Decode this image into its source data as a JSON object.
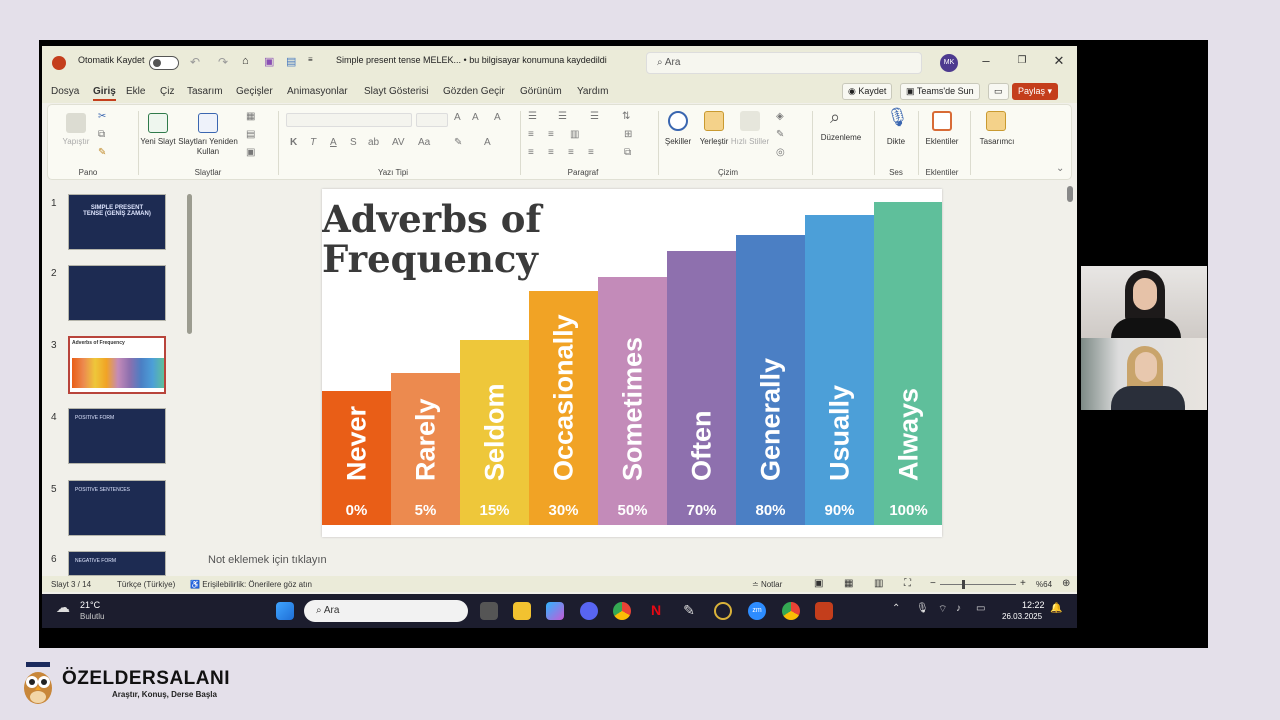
{
  "titlebar": {
    "autosave_label": "Otomatik Kaydet",
    "document_title": "Simple present tense MELEK... • bu bilgisayar konumuna kaydedildi",
    "search_placeholder": "Ara",
    "avatar_initials": "MK"
  },
  "menu_tabs": [
    "Dosya",
    "Giriş",
    "Ekle",
    "Çiz",
    "Tasarım",
    "Geçişler",
    "Animasyonlar",
    "Slayt Gösterisi",
    "Gözden Geçir",
    "Görünüm",
    "Yardım"
  ],
  "active_tab": "Giriş",
  "actions": {
    "save": "Kaydet",
    "teams": "Teams'de Sun",
    "share": "Paylaş"
  },
  "ribbon": {
    "paste": "Yapıştır",
    "new_slide": "Yeni Slayt",
    "reuse_slides": "Slaytları Yeniden Kullan",
    "shapes": "Şekiller",
    "arrange": "Yerleştir",
    "quick_styles": "Hızlı Stiller",
    "editing": "Düzenleme",
    "dictate": "Dikte",
    "addins": "Eklentiler",
    "designer": "Tasarımcı",
    "groups": {
      "clipboard": "Pano",
      "slides": "Slaytlar",
      "font": "Yazı Tipi",
      "paragraph": "Paragraf",
      "drawing": "Çizim",
      "voice": "Ses",
      "addins": "Eklentiler"
    }
  },
  "thumbnails": [
    {
      "num": "1",
      "title": "SIMPLE PRESENT TENSE (GENİŞ ZAMAN)"
    },
    {
      "num": "2",
      "title": ""
    },
    {
      "num": "3",
      "title": "Adverbs of Frequency"
    },
    {
      "num": "4",
      "title": "POSITIVE FORM"
    },
    {
      "num": "5",
      "title": "POSITIVE SENTENCES"
    },
    {
      "num": "6",
      "title": "NEGATIVE FORM"
    }
  ],
  "slide": {
    "title": "Adverbs of\nFrequency",
    "bars": [
      {
        "word": "Never",
        "percent": "0%",
        "level": 0.405,
        "color": "#e95e17"
      },
      {
        "word": "Rarely",
        "percent": "5%",
        "level": 0.46,
        "color": "#ec8a4f"
      },
      {
        "word": "Seldom",
        "percent": "15%",
        "level": 0.56,
        "color": "#eec73a"
      },
      {
        "word": "Occasionally",
        "percent": "30%",
        "level": 0.71,
        "color": "#f1a325"
      },
      {
        "word": "Sometimes",
        "percent": "50%",
        "level": 0.75,
        "color": "#c38bb9"
      },
      {
        "word": "Often",
        "percent": "70%",
        "level": 0.83,
        "color": "#8e70ae"
      },
      {
        "word": "Generally",
        "percent": "80%",
        "level": 0.88,
        "color": "#4b7fc4"
      },
      {
        "word": "Usually",
        "percent": "90%",
        "level": 0.94,
        "color": "#4c9fd8"
      },
      {
        "word": "Always",
        "percent": "100%",
        "level": 0.98,
        "color": "#5fbf9b"
      }
    ]
  },
  "notes_placeholder": "Not eklemek için tıklayın",
  "statusbar": {
    "slide_count": "Slayt 3 / 14",
    "language": "Türkçe (Türkiye)",
    "accessibility": "Erişilebilirlik: Önerilere göz atın",
    "notes": "Notlar",
    "zoom": "%64"
  },
  "taskbar": {
    "weather_temp": "21°C",
    "weather_desc": "Bulutlu",
    "search": "Ara",
    "time": "12:22",
    "date": "26.03.2025"
  },
  "brand": {
    "name": "ÖZELDERSALANI",
    "tagline": "Araştır, Konuş, Derse Başla"
  }
}
